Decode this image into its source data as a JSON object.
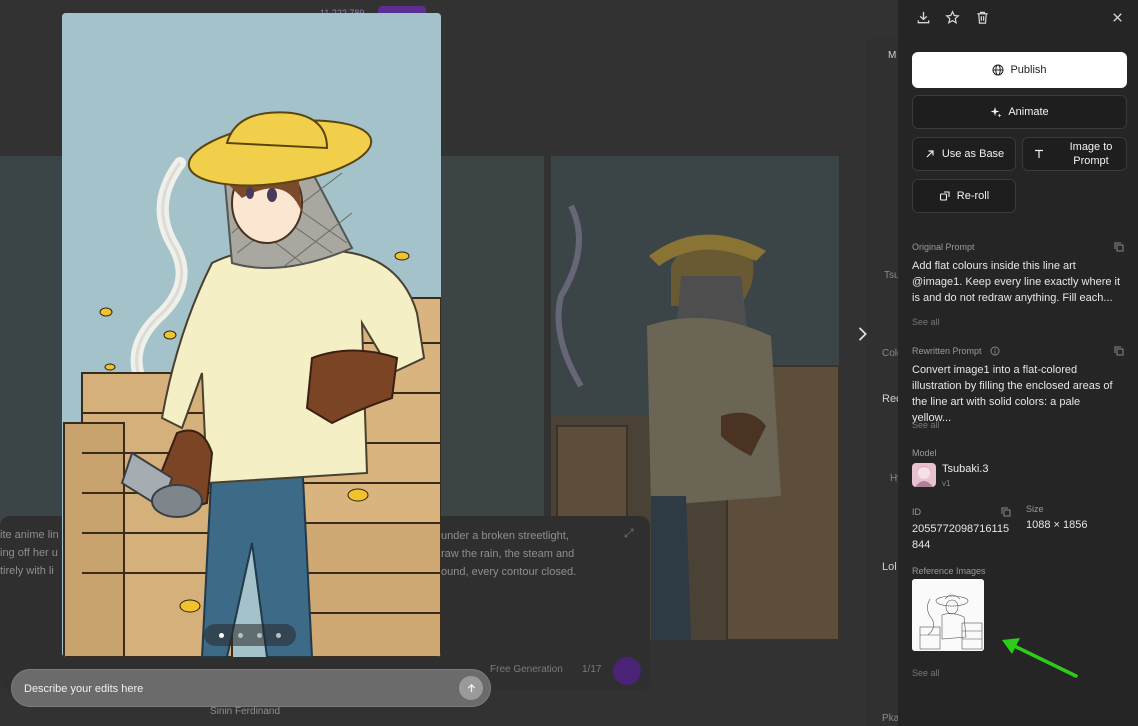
{
  "background": {
    "credits_text": "11,222,789",
    "text_left": [
      "ite anime lin",
      "ing off her u",
      "tirely with li"
    ],
    "text_right": [
      "under a broken streetlight,",
      "raw the rain, the steam and",
      "ound, every contour closed."
    ],
    "generation_label": "Free Generation",
    "generation_count": "1/17",
    "bottom_text": "Sinin Ferdinand",
    "side_items": [
      "M",
      "Tsu",
      "Colo",
      "Rec",
      "Hy",
      "Lol",
      "Pka"
    ]
  },
  "viewer": {
    "dots_total": 4,
    "active_dot": 1
  },
  "edit_input": {
    "placeholder": "Describe your edits here"
  },
  "panel": {
    "toolbar": {
      "download_icon": "download-icon",
      "star_icon": "star-icon",
      "delete_icon": "trash-icon",
      "close_icon": "close-icon"
    },
    "buttons": {
      "publish": "Publish",
      "animate": "Animate",
      "use_as_base": "Use as Base",
      "image_to_prompt": "Image to Prompt",
      "reroll": "Re-roll"
    },
    "original_prompt": {
      "label": "Original Prompt",
      "text": "Add flat colours inside this line art @image1. Keep every line exactly where it is and do not redraw anything. Fill each...",
      "see_all": "See all"
    },
    "rewritten_prompt": {
      "label": "Rewritten Prompt",
      "text": "Convert image1 into a flat-colored illustration by filling the enclosed areas of the line art with solid colors: a pale yellow...",
      "see_all": "See all"
    },
    "model": {
      "label": "Model",
      "name": "Tsubaki.3",
      "version": "v1"
    },
    "id": {
      "label": "ID",
      "value": "2055772098716115844"
    },
    "size": {
      "label": "Size",
      "value": "1088 × 1856"
    },
    "reference_images": {
      "label": "Reference Images",
      "see_all": "See all"
    }
  },
  "colors": {
    "accent_purple": "#5b2f8f",
    "annotation_arrow": "#2ecc1a",
    "panel_bg": "#252525"
  }
}
